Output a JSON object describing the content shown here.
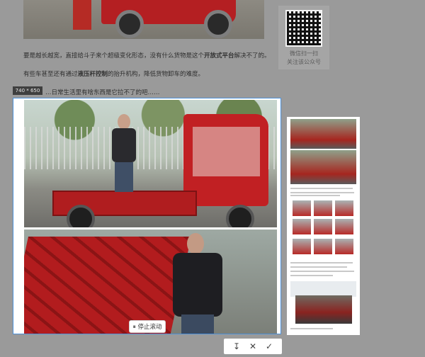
{
  "article": {
    "paragraph1_pre": "要是越长越宽，直接给斗子来个超级变化形态，没有什么货物是这个",
    "paragraph1_bold": "开放式平台",
    "paragraph1_post": "解决不了的。",
    "paragraph2_pre": "有些车甚至还有通过",
    "paragraph2_bold": "液压杆控制",
    "paragraph2_post": "的抬升机构，降低货物卸车的难度。",
    "paragraph3": "…日常生活里有啥东西是它拉不了的吧……",
    "qr_caption_line1": "微信扫一扫",
    "qr_caption_line2": "关注该公众号"
  },
  "capture": {
    "size_badge": "740 * 650",
    "pause_label": "⏸ 停止滚动"
  },
  "toolbar": {
    "download_icon": "↧",
    "close_icon": "✕",
    "confirm_icon": "✓"
  },
  "colors": {
    "selection_border": "#4d90d8",
    "overlay": "#9a9a9a",
    "accent_red": "#b01d1f"
  }
}
